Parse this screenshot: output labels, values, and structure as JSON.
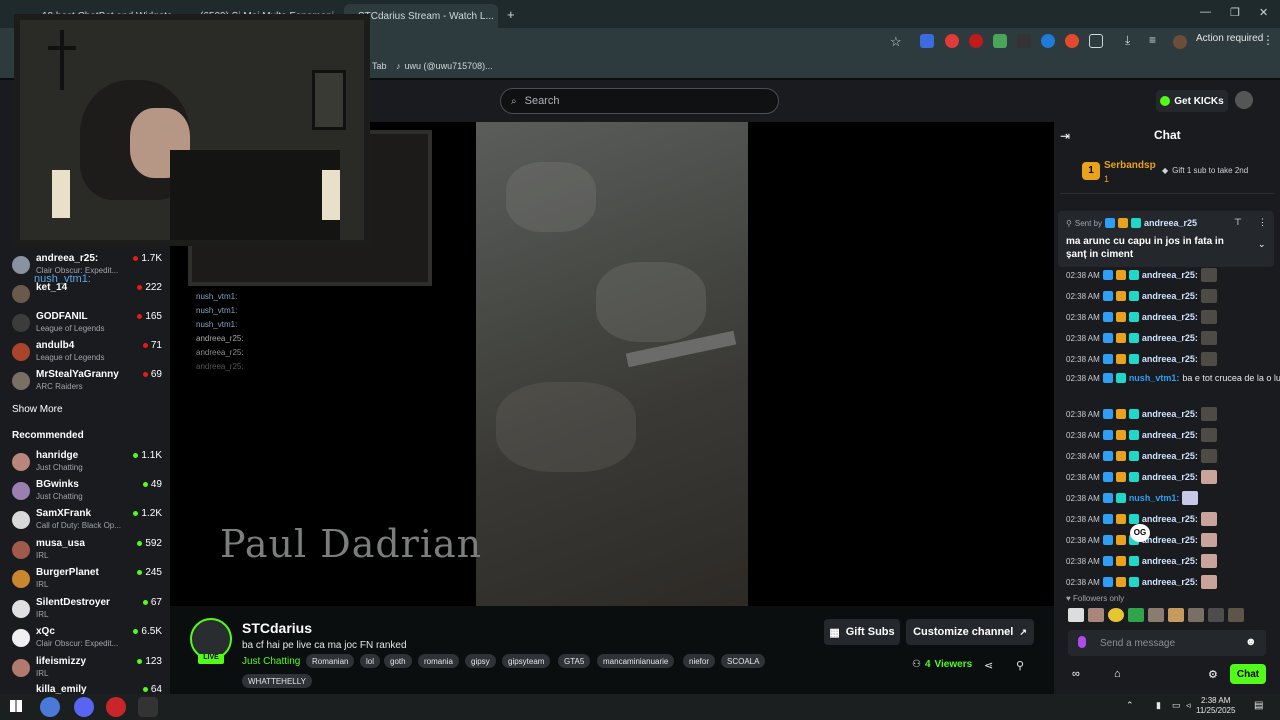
{
  "browser": {
    "tabs": [
      {
        "label": "10 best ChatBot and Widgets"
      },
      {
        "label": "(6509) Si Mai Multe Fenomeni..."
      },
      {
        "label": "STCdarius Stream - Watch L..."
      }
    ],
    "action_required": "Action required",
    "bookmarks": [
      "Tab",
      "uwu (@uwu715708)..."
    ]
  },
  "header": {
    "search_placeholder": "Search",
    "get_kicks": "Get KICKs"
  },
  "sidebar": {
    "following": [
      {
        "name": "andreea_r25:",
        "category": "Clair Obscur: Expedit...",
        "viewers": "1.7K"
      },
      {
        "name": "ket_14",
        "category": "",
        "viewers": "222"
      },
      {
        "name": "GODFANIL",
        "category": "League of Legends",
        "viewers": "165"
      },
      {
        "name": "andulb4",
        "category": "League of Legends",
        "viewers": "71"
      },
      {
        "name": "MrStealYaGranny",
        "category": "ARC Raiders",
        "viewers": "69"
      }
    ],
    "show_more": "Show More",
    "recommended_title": "Recommended",
    "recommended": [
      {
        "name": "hanridge",
        "category": "Just Chatting",
        "viewers": "1.1K"
      },
      {
        "name": "BGwinks",
        "category": "Just Chatting",
        "viewers": "49"
      },
      {
        "name": "SamXFrank",
        "category": "Call of Duty: Black Op...",
        "viewers": "1.2K"
      },
      {
        "name": "musa_usa",
        "category": "IRL",
        "viewers": "592"
      },
      {
        "name": "BurgerPlanet",
        "category": "IRL",
        "viewers": "245"
      },
      {
        "name": "SilentDestroyer",
        "category": "IRL",
        "viewers": "67"
      },
      {
        "name": "xQc",
        "category": "Clair Obscur: Expedit...",
        "viewers": "6.5K"
      },
      {
        "name": "lifeismizzy",
        "category": "IRL",
        "viewers": "123"
      },
      {
        "name": "killa_emily",
        "category": "",
        "viewers": "64"
      }
    ]
  },
  "video": {
    "watermark": "Paul Dadrian",
    "overlay_chat": [
      "nush_vtm1:",
      "nush_vtm1:",
      "nush_vtm1:",
      "andreea_r25:",
      "andreea_r25:",
      "andreea_r25:"
    ],
    "left_overlay": [
      "andreea_r25:",
      "nush_vtm1:",
      "andreea_r25:",
      "andreea_r25:",
      "andreea_r25:",
      "andreea_r25:"
    ]
  },
  "stream": {
    "streamer": "STCdarius",
    "live": "LIVE",
    "title": "ba cf hai pe live ca ma joc FN ranked",
    "category": "Just Chatting",
    "tags": [
      "Romanian",
      "lol",
      "goth",
      "romania",
      "gipsy",
      "gipsyteam",
      "GTA5",
      "mancaminianuarie",
      "niefor",
      "SCOALA",
      "WHATTEHELLY"
    ],
    "gift_subs": "Gift Subs",
    "customize": "Customize channel",
    "viewers_count": "4",
    "viewers_label": "Viewers"
  },
  "chat": {
    "title": "Chat",
    "gifter_rank": "1",
    "gifter_name": "Serbandsp",
    "gifter_count": "1",
    "gift_prompt": "Gift 1 sub to take 2nd",
    "pinned_by_label": "Sent by",
    "pinned_by_user": "andreea_r25",
    "pinned_text": "ma arunc cu capu in jos in fata in șanț in ciment",
    "messages": [
      {
        "time": "02:38 AM",
        "user": "andreea_r25:",
        "text": ""
      },
      {
        "time": "02:38 AM",
        "user": "andreea_r25:",
        "text": ""
      },
      {
        "time": "02:38 AM",
        "user": "andreea_r25:",
        "text": ""
      },
      {
        "time": "02:38 AM",
        "user": "andreea_r25:",
        "text": ""
      },
      {
        "time": "02:38 AM",
        "user": "andreea_r25:",
        "text": ""
      },
      {
        "time": "02:38 AM",
        "user": "nush_vtm1:",
        "text": "ba e tot crucea de la o luna"
      },
      {
        "time": "02:38 AM",
        "user": "andreea_r25:",
        "text": ""
      },
      {
        "time": "02:38 AM",
        "user": "andreea_r25:",
        "text": ""
      },
      {
        "time": "02:38 AM",
        "user": "andreea_r25:",
        "text": ""
      },
      {
        "time": "02:38 AM",
        "user": "andreea_r25:",
        "text": ""
      },
      {
        "time": "02:38 AM",
        "user": "nush_vtm1:",
        "text": ""
      },
      {
        "time": "02:38 AM",
        "user": "andreea_r25:",
        "text": ""
      },
      {
        "time": "02:38 AM",
        "user": "andreea_r25:",
        "text": ""
      },
      {
        "time": "02:38 AM",
        "user": "andreea_r25:",
        "text": ""
      },
      {
        "time": "02:38 AM",
        "user": "andreea_r25:",
        "text": ""
      }
    ],
    "og_emote": "OG",
    "followers_only": "Followers only",
    "input_placeholder": "Send a message",
    "chat_button": "Chat"
  },
  "taskbar": {
    "time": "2:38 AM",
    "date": "11/25/2025"
  },
  "colors": {
    "kick_green": "#53fc18",
    "live_red": "#e91916",
    "chat_user_blue": "#2f9ef5",
    "chat_user_white": "#cfe3ff"
  }
}
